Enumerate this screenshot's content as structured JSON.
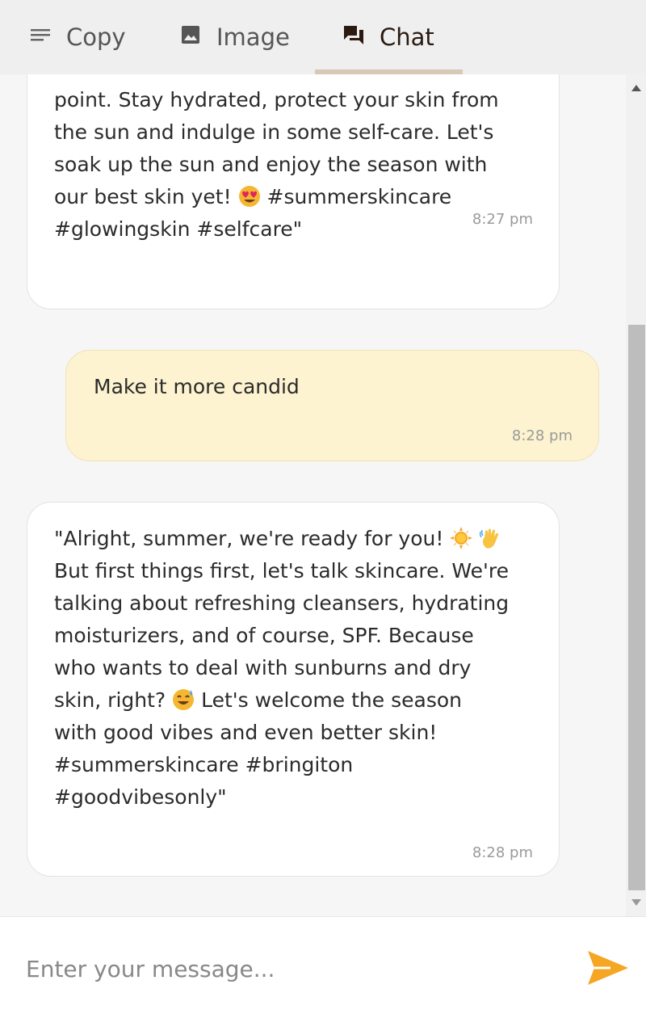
{
  "tabs": [
    {
      "label": "Copy",
      "icon": "text-lines-icon"
    },
    {
      "label": "Image",
      "icon": "image-icon"
    },
    {
      "label": "Chat",
      "icon": "chat-icon",
      "active": true
    }
  ],
  "messages": [
    {
      "sender": "assistant",
      "text": "point. Stay hydrated, protect your skin from\nthe sun and indulge in some self-care. Let's\nsoak up the sun and enjoy the season with\nour best skin yet!",
      "text_tail": " #summerskincare\n#glowingskin #selfcare\"",
      "emoji": "heart-eyes-emoji",
      "time": "8:27 pm"
    },
    {
      "sender": "user",
      "text": "Make it more candid",
      "time": "8:28 pm"
    },
    {
      "sender": "assistant",
      "line1": "\"Alright, summer, we're ready for you!",
      "line2": "But first things first, let's talk skincare. We're\ntalking about refreshing cleansers, hydrating\nmoisturizers, and of course, SPF. Because\nwho wants to deal with sunburns and dry\nskin, right?",
      "line3": " Let's welcome the season\nwith good vibes and even better skin!\n#summerskincare #bringiton\n#goodvibesonly\"",
      "emojis": [
        "sun-emoji",
        "waving-hand-emoji",
        "sweat-smile-emoji"
      ],
      "time": "8:28 pm"
    }
  ],
  "input": {
    "placeholder": "Enter your message..."
  },
  "colors": {
    "accent": "#f5a623",
    "user_bubble": "#fdf3d0",
    "tab_bar": "#efefef"
  }
}
